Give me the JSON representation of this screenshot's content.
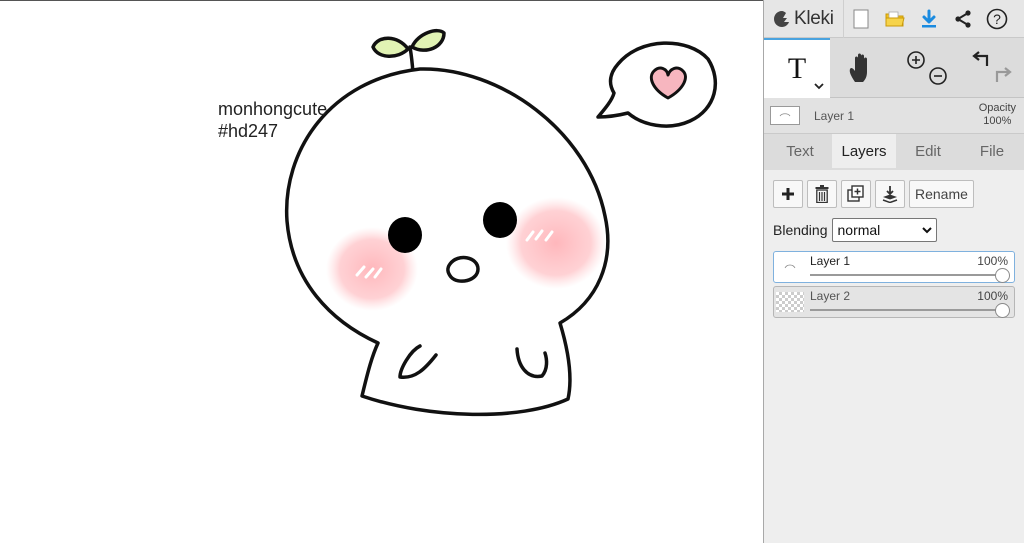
{
  "app": {
    "name": "Kleki"
  },
  "canvas": {
    "text_lines": [
      "monhongcute",
      "#hd247"
    ]
  },
  "topbar": {
    "icons": [
      "kleki-logo-icon",
      "new-file-icon",
      "open-folder-icon",
      "download-icon",
      "share-icon",
      "help-icon"
    ],
    "help_label": "?"
  },
  "tools": {
    "text_tool": "T",
    "icons": [
      "text-tool-icon",
      "hand-tool-icon",
      "zoom-in-icon",
      "zoom-out-icon",
      "undo-icon",
      "redo-icon"
    ]
  },
  "layer_strip": {
    "name": "Layer 1",
    "opacity_label": "Opacity",
    "opacity_value": "100%"
  },
  "tabs": [
    "Text",
    "Layers",
    "Edit",
    "File"
  ],
  "layers_panel": {
    "rename_label": "Rename",
    "blending_label": "Blending",
    "blending_value": "normal",
    "layers": [
      {
        "name": "Layer 1",
        "opacity": "100%",
        "opacity_fraction": 1.0,
        "active": true
      },
      {
        "name": "Layer 2",
        "opacity": "100%",
        "opacity_fraction": 1.0,
        "active": false
      }
    ]
  },
  "colors": {
    "accent": "#4aa3df",
    "download_blue": "#1a8be0",
    "folder_yellow": "#f2c21b",
    "sprout_green": "#e1f3b4",
    "blush_pink": "#ffb3b8",
    "heart_pink": "#f7b6bf"
  }
}
